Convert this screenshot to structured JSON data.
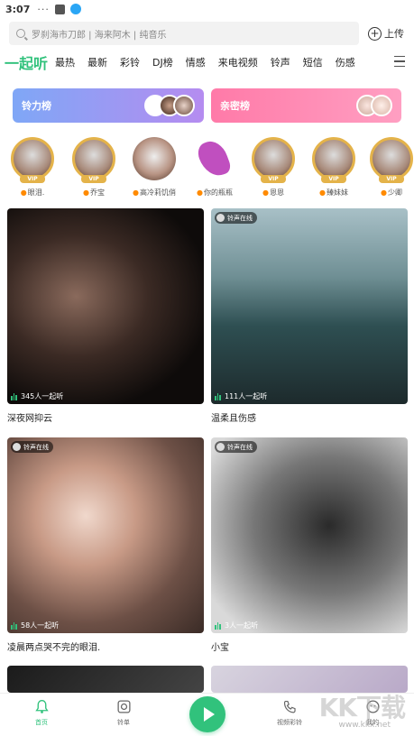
{
  "status_bar": {
    "time": "3:07",
    "dots": "···"
  },
  "search": {
    "placeholder": "罗刹海市刀郎 | 海来阿木 | 纯音乐",
    "upload_label": "上传"
  },
  "tabs": [
    "一起听",
    "最热",
    "最新",
    "彩铃",
    "DJ榜",
    "情感",
    "来电视频",
    "铃声",
    "短信",
    "伤感"
  ],
  "banners": [
    {
      "label": "铃力榜"
    },
    {
      "label": "亲密榜"
    }
  ],
  "avatars": [
    {
      "label": "眼泪.",
      "vip": true
    },
    {
      "label": "乔宝",
      "vip": true
    },
    {
      "label": "高冷莉饥俏",
      "vip": false
    },
    {
      "label": "你的瓶瓶",
      "vip": false
    },
    {
      "label": "恩恩",
      "vip": true
    },
    {
      "label": "臻妹妹",
      "vip": true
    },
    {
      "label": "少卿",
      "vip": true
    }
  ],
  "vip_text": "VIP",
  "cards": [
    {
      "listeners": "345人一起听",
      "caption": "深夜网抑云",
      "tag": ""
    },
    {
      "listeners": "111人一起听",
      "caption": "温柔且伤感",
      "tag": "铃声在线"
    },
    {
      "listeners": "58人一起听",
      "caption": "凌晨两点哭不完的眼泪.",
      "tag": "铃声在线"
    },
    {
      "listeners": "3人一起听",
      "caption": "小宝",
      "tag": "铃声在线"
    },
    {
      "listeners": "",
      "caption": "",
      "tag": ""
    },
    {
      "listeners": "",
      "caption": "",
      "tag": ""
    }
  ],
  "bottom_nav": [
    {
      "label": "首页",
      "icon": "bell-icon",
      "active": true
    },
    {
      "label": "铃单",
      "icon": "playlist-icon",
      "active": false
    },
    {
      "label": "视频彩铃",
      "icon": "phone-video-icon",
      "active": false
    },
    {
      "label": "我的",
      "icon": "profile-icon",
      "active": false
    }
  ],
  "watermark": {
    "text": "KK下载",
    "url": "www.kkx.net"
  },
  "colors": {
    "accent": "#31c27c",
    "vip_gold": "#e4b34a"
  }
}
